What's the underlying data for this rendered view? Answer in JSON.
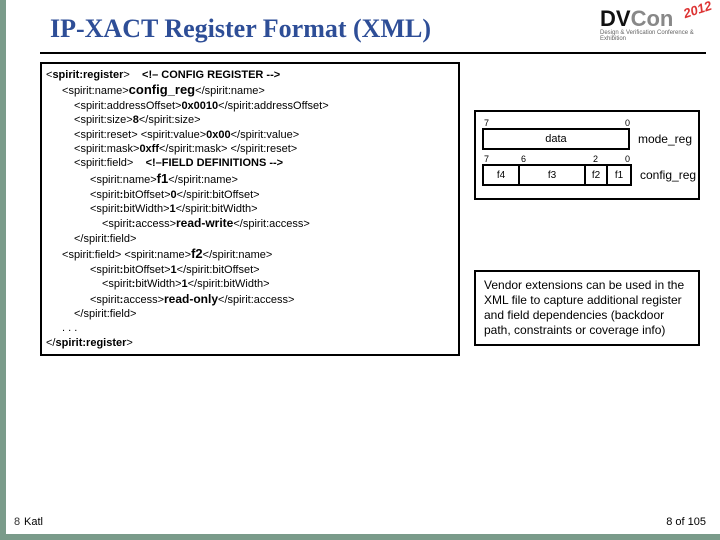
{
  "logo": {
    "dv": "DV",
    "con": "Con",
    "year": "2012",
    "sub": "Design & Verification Conference & Exhibition"
  },
  "title": "IP-XACT Register Format (XML)",
  "xml": {
    "register_open": "spirit:register",
    "comment1": "<!– CONFIG REGISTER -->",
    "name_open": "spirit:name",
    "name_val": "config_reg",
    "name_close": "spirit:name",
    "addr_open": "spirit:addressOffset",
    "addr_val": "0x0010",
    "addr_close": "spirit:addressOffset",
    "size_open": "spirit:size",
    "size_val": "8",
    "size_close": "spirit:size",
    "reset_open": "spirit:reset",
    "value_open": "spirit:value",
    "value_val": "0x00",
    "value_close": "spirit:value",
    "mask_open": "spirit:mask",
    "mask_val": "0xff",
    "mask_close": "spirit:mask",
    "reset_close": "spirit:reset",
    "field_open": "spirit:field",
    "comment2": "<!–FIELD DEFINITIONS -->",
    "f1_name": "f1",
    "bitoffset_open": "spirit:bitOffset",
    "bitoffset0": "0",
    "bitoffset_close": "spirit:bitOffset",
    "bitwidth_open": "spirit:bitWidth",
    "bitwidth1": "1",
    "bitwidth_close": "spirit:bitWidth",
    "access_open": "spirit:access",
    "access_rw": "read-write",
    "access_close": "spirit:access",
    "field_close": "spirit:field",
    "f2_name": "f2",
    "bitoffset1": "1",
    "access_ro": "read-only",
    "dots": ". . .",
    "register_close": "spirit:register"
  },
  "diagram": {
    "top_bits_hi": "7",
    "top_bits_lo": "0",
    "data_label": "data",
    "mode_label": "mode_reg",
    "bits": {
      "b7": "7",
      "b6": "6",
      "b2": "2",
      "b0": "0"
    },
    "fields": {
      "f4": "f4",
      "f3": "f3",
      "f2": "f2",
      "f1": "f1"
    },
    "config_label": "config_reg"
  },
  "note": "Vendor extensions can be used in the XML file to capture additional register and field dependencies (backdoor path, constraints or coverage info)",
  "footer_left": "8",
  "footer_author": "Katl",
  "page": "8 of 105"
}
